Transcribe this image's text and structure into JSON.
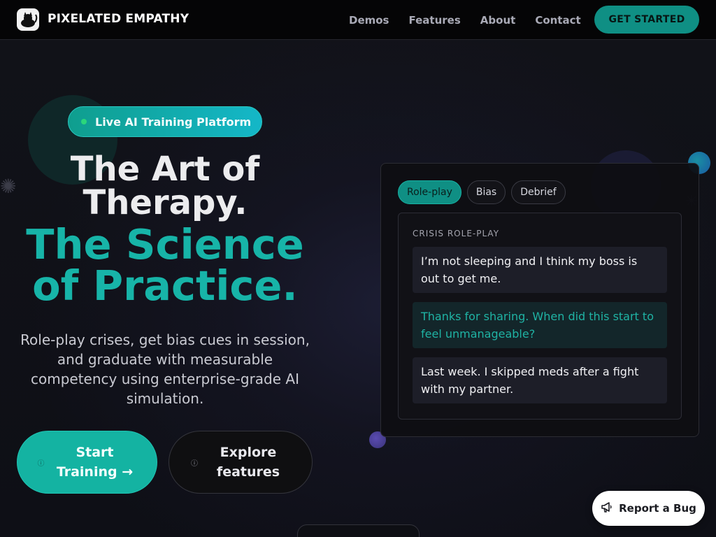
{
  "header": {
    "brand": "PIXELATED EMPATHY",
    "nav": [
      "Demos",
      "Features",
      "About",
      "Contact"
    ],
    "cta": "GET STARTED"
  },
  "hero": {
    "badge": "Live AI Training Platform",
    "headline_line1": "The Art of",
    "headline_line2": "Therapy.",
    "accent_line1": "The Science",
    "accent_line2": "of Practice.",
    "subtitle": "Role-play crises, get bias cues in session, and graduate with measurable competency using enterprise-grade AI simulation.",
    "primary_button": "Start Training →",
    "secondary_button": "Explore features"
  },
  "demo_card": {
    "tabs": [
      "Role-play",
      "Bias",
      "Debrief"
    ],
    "active_tab": "Role-play",
    "panel_title": "CRISIS ROLE-PLAY",
    "messages": [
      {
        "role": "client",
        "text": "I’m not sleeping and I think my boss is out to get me."
      },
      {
        "role": "therapist",
        "text": "Thanks for sharing. When did this start to feel unmanageable?"
      },
      {
        "role": "client",
        "text": "Last week. I skipped meds after a fight with my partner."
      }
    ]
  },
  "report": {
    "label": "Report a Bug"
  },
  "icons": {
    "logo": "cat-logo-icon",
    "badge_dot": "status-dot-icon",
    "primary_button_icon": "info-icon",
    "secondary_button_icon": "info-icon",
    "report_icon": "megaphone-icon"
  },
  "colors": {
    "accent": "#17b4a8",
    "background": "#0c0d12",
    "nav_background": "#050506"
  }
}
